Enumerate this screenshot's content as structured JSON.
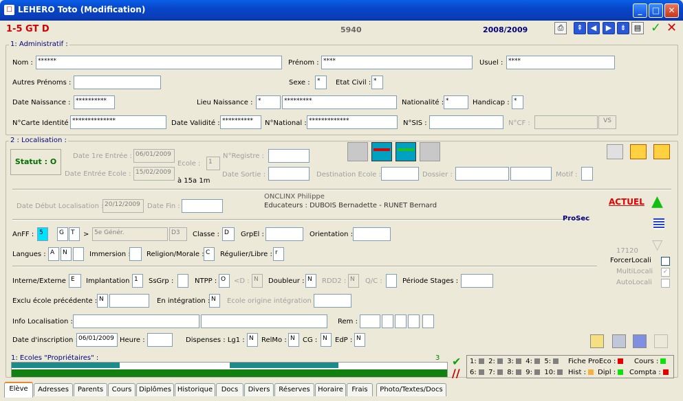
{
  "window": {
    "title": "LEHERO Toto (Modification)",
    "icon": "app-icon"
  },
  "header": {
    "classe": "1-5 GT D",
    "numero": "5940",
    "annee": "2008/2009"
  },
  "admin": {
    "legend": "1: Administratif :",
    "nom_label": "Nom :",
    "nom": "******",
    "prenom_label": "Prénom :",
    "prenom": "****",
    "usuel_label": "Usuel :",
    "usuel": "****",
    "autres_prenoms_label": "Autres Prénoms :",
    "autres_prenoms": "",
    "sexe_label": "Sexe :",
    "sexe": "*",
    "etat_civil_label": "Etat Civil :",
    "etat_civil": "*",
    "date_naissance_label": "Date Naissance :",
    "date_naissance": "**********",
    "lieu_naissance_label": "Lieu Naissance :",
    "lieu_naissance_code": "*",
    "lieu_naissance": "*********",
    "nationalite_label": "Nationalité :",
    "nationalite": "*",
    "handicap_label": "Handicap :",
    "handicap": "*",
    "carte_label": "N°Carte Identité :",
    "carte": "**************",
    "validite_label": "Date Validité :",
    "validite": "**********",
    "national_label": "N°National :",
    "national": "*************",
    "sis_label": "N°SIS :",
    "sis": "",
    "ncf_label": "N°CF :",
    "ncf": "",
    "vs_label": "VS"
  },
  "local": {
    "legend": "2 : Localisation :",
    "statut": "Statut : O",
    "date1_label": "Date 1re Entrée :",
    "date1": "06/01/2009",
    "date_entree_label": "Date Entrée Ecole :",
    "date_entree": "15/02/2009",
    "ecole_label": "Ecole :",
    "ecole": "1",
    "age": "à 15a 1m",
    "registre_label": "N°Registre :",
    "registre": "",
    "sortie_label": "Date Sortie :",
    "sortie": "",
    "destination_label": "Destination Ecole :",
    "destination": "",
    "dossier_label": "Dossier :",
    "dossier1": "",
    "dossier2": "",
    "motif_label": "Motif :",
    "motif": "",
    "debut_label": "Date Début Localisation :",
    "debut": "20/12/2009",
    "fin_label": "Date Fin :",
    "fin": "",
    "titulaire": "ONCLINX Philippe",
    "educateurs": "Educateurs : DUBOIS Bernadette - RUNET Bernard",
    "actuel": "ACTUEL",
    "prosec": "ProSec",
    "code17120": "17120"
  },
  "scol": {
    "anff_label": "AnFF :",
    "anff1": "5",
    "anff2": "G",
    "anff3": "T",
    "gt": ">",
    "genre": "5e Génér.",
    "d3": "D3",
    "classe_label": "Classe :",
    "classe": "D",
    "grpel_label": "GrpEl :",
    "grpel": "",
    "orientation_label": "Orientation :",
    "orientation": "",
    "langues_label": "Langues :",
    "lang1": "A",
    "lang2": "N",
    "lang3": "",
    "immersion_label": "Immersion :",
    "immersion": "",
    "religion_label": "Religion/Morale :",
    "religion": "C",
    "regulier_label": "Régulier/Libre :",
    "regulier": "r",
    "forcer_label": "ForcerLocali",
    "multi_label": "MultiLocali",
    "auto_label": "AutoLocali",
    "interne_label": "Interne/Externe :",
    "interne": "E",
    "implant_label": "Implantation :",
    "implant": "1",
    "ssgrp_label": "SsGrp :",
    "ssgrp": "",
    "ntpp_label": "NTPP :",
    "ntpp": "O",
    "lt_d_label": "<D :",
    "lt_d": "N",
    "doubleur_label": "Doubleur :",
    "doubleur": "N",
    "rdd2_label": "RDD2 :",
    "rdd2": "N",
    "qc_label": "Q/C :",
    "qc": "",
    "stages_label": "Période Stages :",
    "stages": "",
    "exclu_label": "Exclu école précédente :",
    "exclu": "N",
    "exclu2": "",
    "integration_label": "En intégration :",
    "integration": "N",
    "origine_label": "Ecole origine intégration :",
    "origine": "",
    "info_label": "Info Localisation :",
    "info1": "",
    "info2": "",
    "rem_label": "Rem :",
    "inscription_label": "Date d'inscription :",
    "inscription": "06/01/2009",
    "heure_label": "Heure :",
    "heure": "",
    "dispenses_label": "Dispenses : Lg1 :",
    "lg1": "N",
    "relmo_label": "RelMo :",
    "relmo": "N",
    "cg_label": "CG :",
    "cg": "N",
    "edp_label": "EdP :",
    "edp": "N"
  },
  "ecoles": {
    "label": "1: Ecoles \"Propriétaires\" :",
    "count": "3"
  },
  "legend_status": {
    "r1": [
      "1:",
      "2:",
      "3:",
      "4:",
      "5:"
    ],
    "r2": [
      "6:",
      "7:",
      "8:",
      "9:",
      "10:"
    ],
    "fiche": "Fiche ProEco :",
    "cours": "Cours :",
    "hist": "Hist :",
    "dipl": "Dipl :",
    "compta": "Compta :"
  },
  "tabs": [
    "Elève",
    "Adresses",
    "Parents",
    "Cours",
    "Diplômes",
    "Historique",
    "Docs",
    "Divers",
    "Réserves",
    "Horaire",
    "Frais",
    "Photo/Textes/Docs"
  ]
}
